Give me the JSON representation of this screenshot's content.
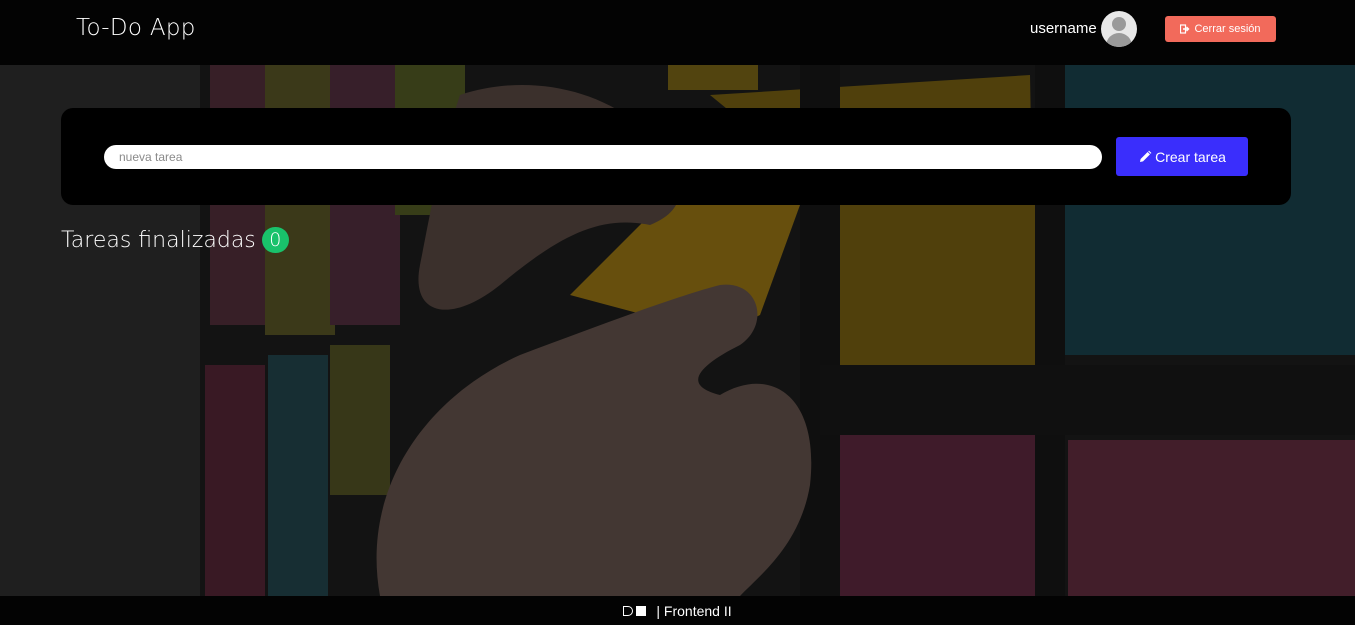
{
  "header": {
    "app_title": "To-Do App",
    "username": "username",
    "logout_label": "Cerrar sesión"
  },
  "new_task": {
    "placeholder": "nueva tarea",
    "value": "",
    "create_label": "Crear tarea"
  },
  "finished": {
    "title": "Tareas finalizadas",
    "count": "0"
  },
  "footer": {
    "text": "| Frontend II"
  },
  "colors": {
    "logout_button": "#f26a5b",
    "create_button": "#3a2efc",
    "count_badge": "#19c26b"
  },
  "icons": [
    "user-avatar-icon",
    "sign-out-icon",
    "pencil-icon",
    "dh-logo-icon"
  ]
}
